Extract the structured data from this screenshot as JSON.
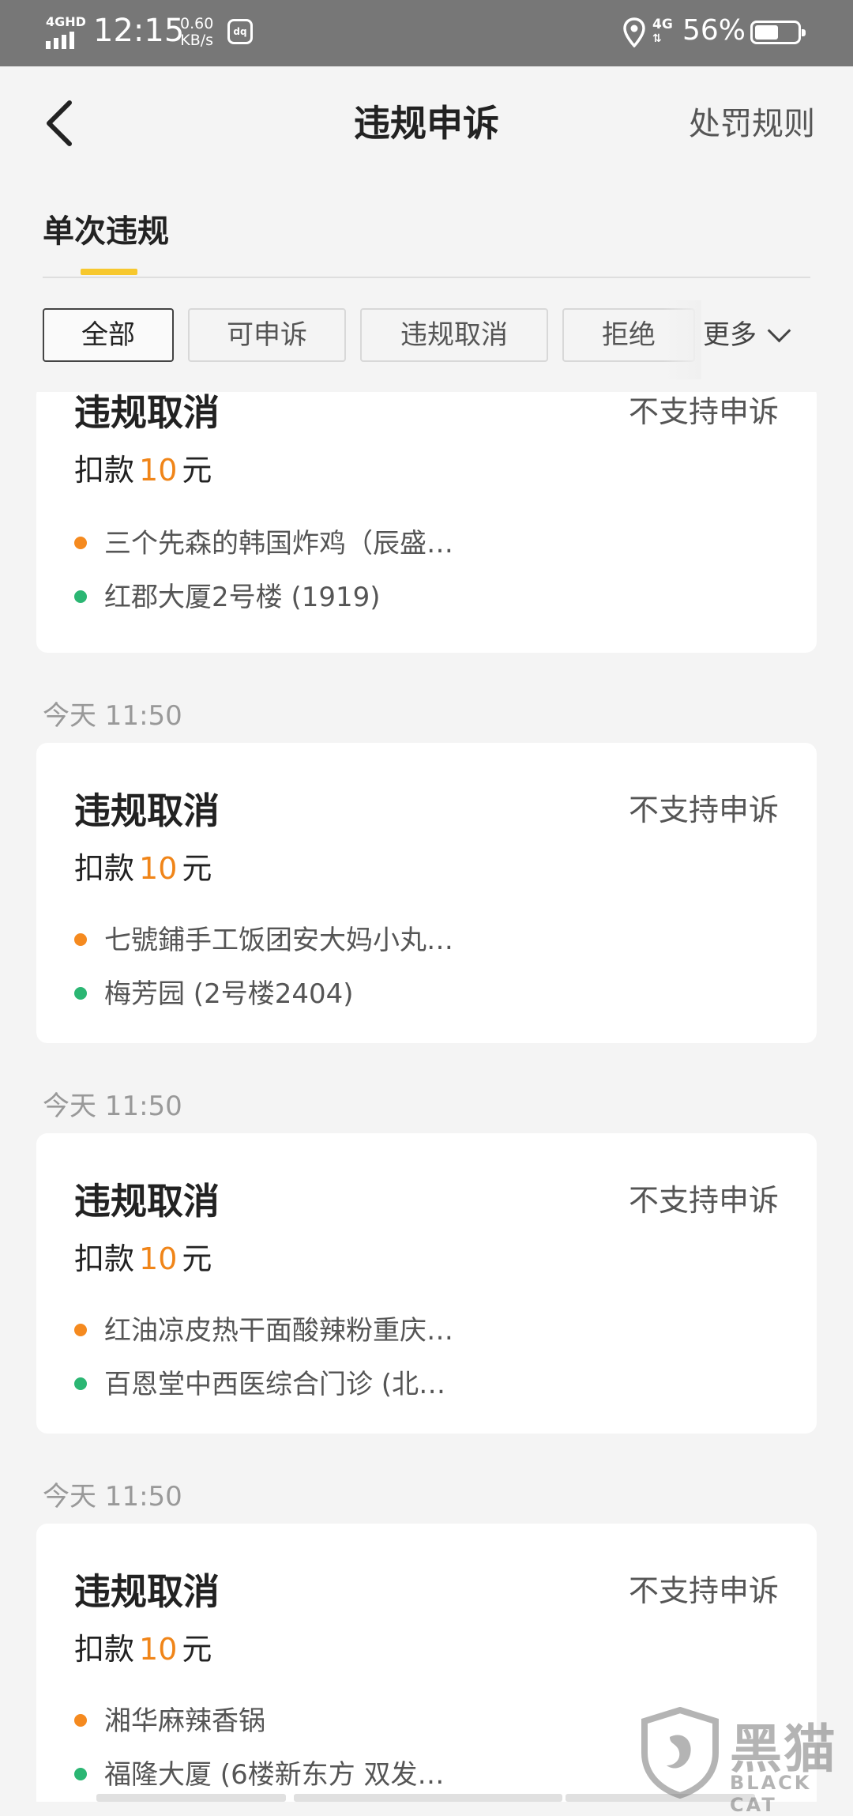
{
  "status_bar": {
    "network_tag": "4GHD",
    "time": "12:15",
    "speed_value": "0.60",
    "speed_unit": "KB/s",
    "net_type": "4G",
    "battery": "56%",
    "battery_level": 0.56
  },
  "header": {
    "title": "违规申诉",
    "rules_link": "处罚规则"
  },
  "tabs": {
    "single": "单次违规"
  },
  "filters": {
    "items": [
      "全部",
      "可申诉",
      "违规取消",
      "拒绝"
    ],
    "selected_index": 0,
    "more": "更多"
  },
  "records": [
    {
      "date": "",
      "status": "违规取消",
      "appeal": "不支持申诉",
      "deduct_prefix": "扣款",
      "amount": "10",
      "unit": "元",
      "shop": "三个先森的韩国炸鸡（辰盛…",
      "address": "红郡大厦2号楼 (1919)"
    },
    {
      "date": "今天 11:50",
      "status": "违规取消",
      "appeal": "不支持申诉",
      "deduct_prefix": "扣款",
      "amount": "10",
      "unit": "元",
      "shop": "七號鋪手工饭团安大妈小丸…",
      "address": "梅芳园 (2号楼2404)"
    },
    {
      "date": "今天 11:50",
      "status": "违规取消",
      "appeal": "不支持申诉",
      "deduct_prefix": "扣款",
      "amount": "10",
      "unit": "元",
      "shop": "红油凉皮热干面酸辣粉重庆…",
      "address": "百恩堂中西医综合门诊 (北…"
    },
    {
      "date": "今天 11:50",
      "status": "违规取消",
      "appeal": "不支持申诉",
      "deduct_prefix": "扣款",
      "amount": "10",
      "unit": "元",
      "shop": "湘华麻辣香锅",
      "address": "福隆大厦 (6楼新东方  双发…"
    }
  ],
  "watermark": {
    "text": "黑猫",
    "sub": "BLACK CAT"
  },
  "colors": {
    "accent_yellow": "#f7c82e",
    "amount_orange": "#f08519",
    "shop_dot": "#f58a1f",
    "address_dot": "#2bb673"
  }
}
